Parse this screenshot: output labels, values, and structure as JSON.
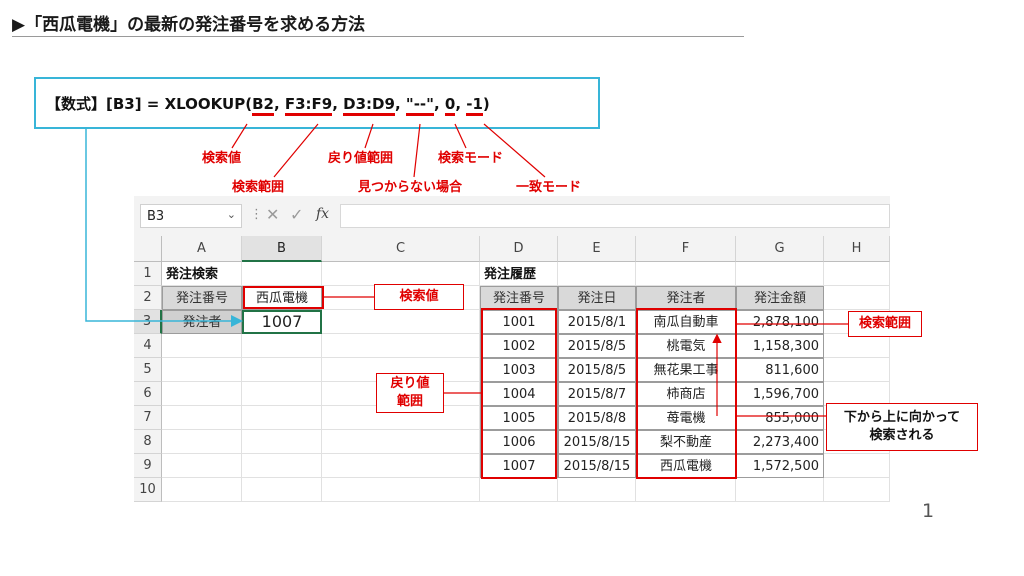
{
  "slide": {
    "title": "▶「西瓜電機」の最新の発注番号を求める方法",
    "page_number": "1"
  },
  "formula": {
    "prefix": "【数式】[B3] = XLOOKUP(",
    "arg1": "B2",
    "sep": ", ",
    "arg2": "F3:F9",
    "arg3": "D3:D9",
    "arg4": "\"--\"",
    "arg5": "0",
    "arg6": "-1",
    "suffix": ")"
  },
  "annotations": {
    "lookup_value": "検索値",
    "lookup_range": "検索範囲",
    "return_range": "戻り値範囲",
    "if_not_found": "見つからない場合",
    "search_mode": "検索モード",
    "match_mode": "一致モード"
  },
  "callouts": {
    "lookup_value": "検索値",
    "lookup_range": "検索範囲",
    "return_range_line1": "戻り値",
    "return_range_line2": "範囲",
    "search_note_line1": "下から上に向かって",
    "search_note_line2": "検索される"
  },
  "excel": {
    "name_box": "B3",
    "name_box_dropdown": "⌄",
    "formula_bar_sep": "⋮",
    "cancel_icon": "✕",
    "enter_icon": "✓",
    "fx_label": "fx",
    "formula_value": "",
    "columns": [
      "A",
      "B",
      "C",
      "D",
      "E",
      "F",
      "G",
      "H"
    ],
    "rows": [
      "1",
      "2",
      "3",
      "4",
      "5",
      "6",
      "7",
      "8",
      "9",
      "10"
    ],
    "cells": {
      "A1": "発注検索",
      "A2": "発注番号",
      "B2": "西瓜電機",
      "A3": "発注者",
      "B3": "1007",
      "D1": "発注履歴"
    },
    "history_headers": [
      "発注番号",
      "発注日",
      "発注者",
      "発注金額"
    ],
    "history_rows": [
      [
        "1001",
        "2015/8/1",
        "南瓜自動車",
        "2,878,100"
      ],
      [
        "1002",
        "2015/8/5",
        "桃電気",
        "1,158,300"
      ],
      [
        "1003",
        "2015/8/5",
        "無花果工事",
        "811,600"
      ],
      [
        "1004",
        "2015/8/7",
        "柿商店",
        "1,596,700"
      ],
      [
        "1005",
        "2015/8/8",
        "苺電機",
        "855,000"
      ],
      [
        "1006",
        "2015/8/15",
        "梨不動産",
        "2,273,400"
      ],
      [
        "1007",
        "2015/8/15",
        "西瓜電機",
        "1,572,500"
      ]
    ]
  },
  "colors": {
    "accent_cyan": "#38b5d8",
    "annotation_red": "#e00000",
    "excel_green": "#217346"
  }
}
